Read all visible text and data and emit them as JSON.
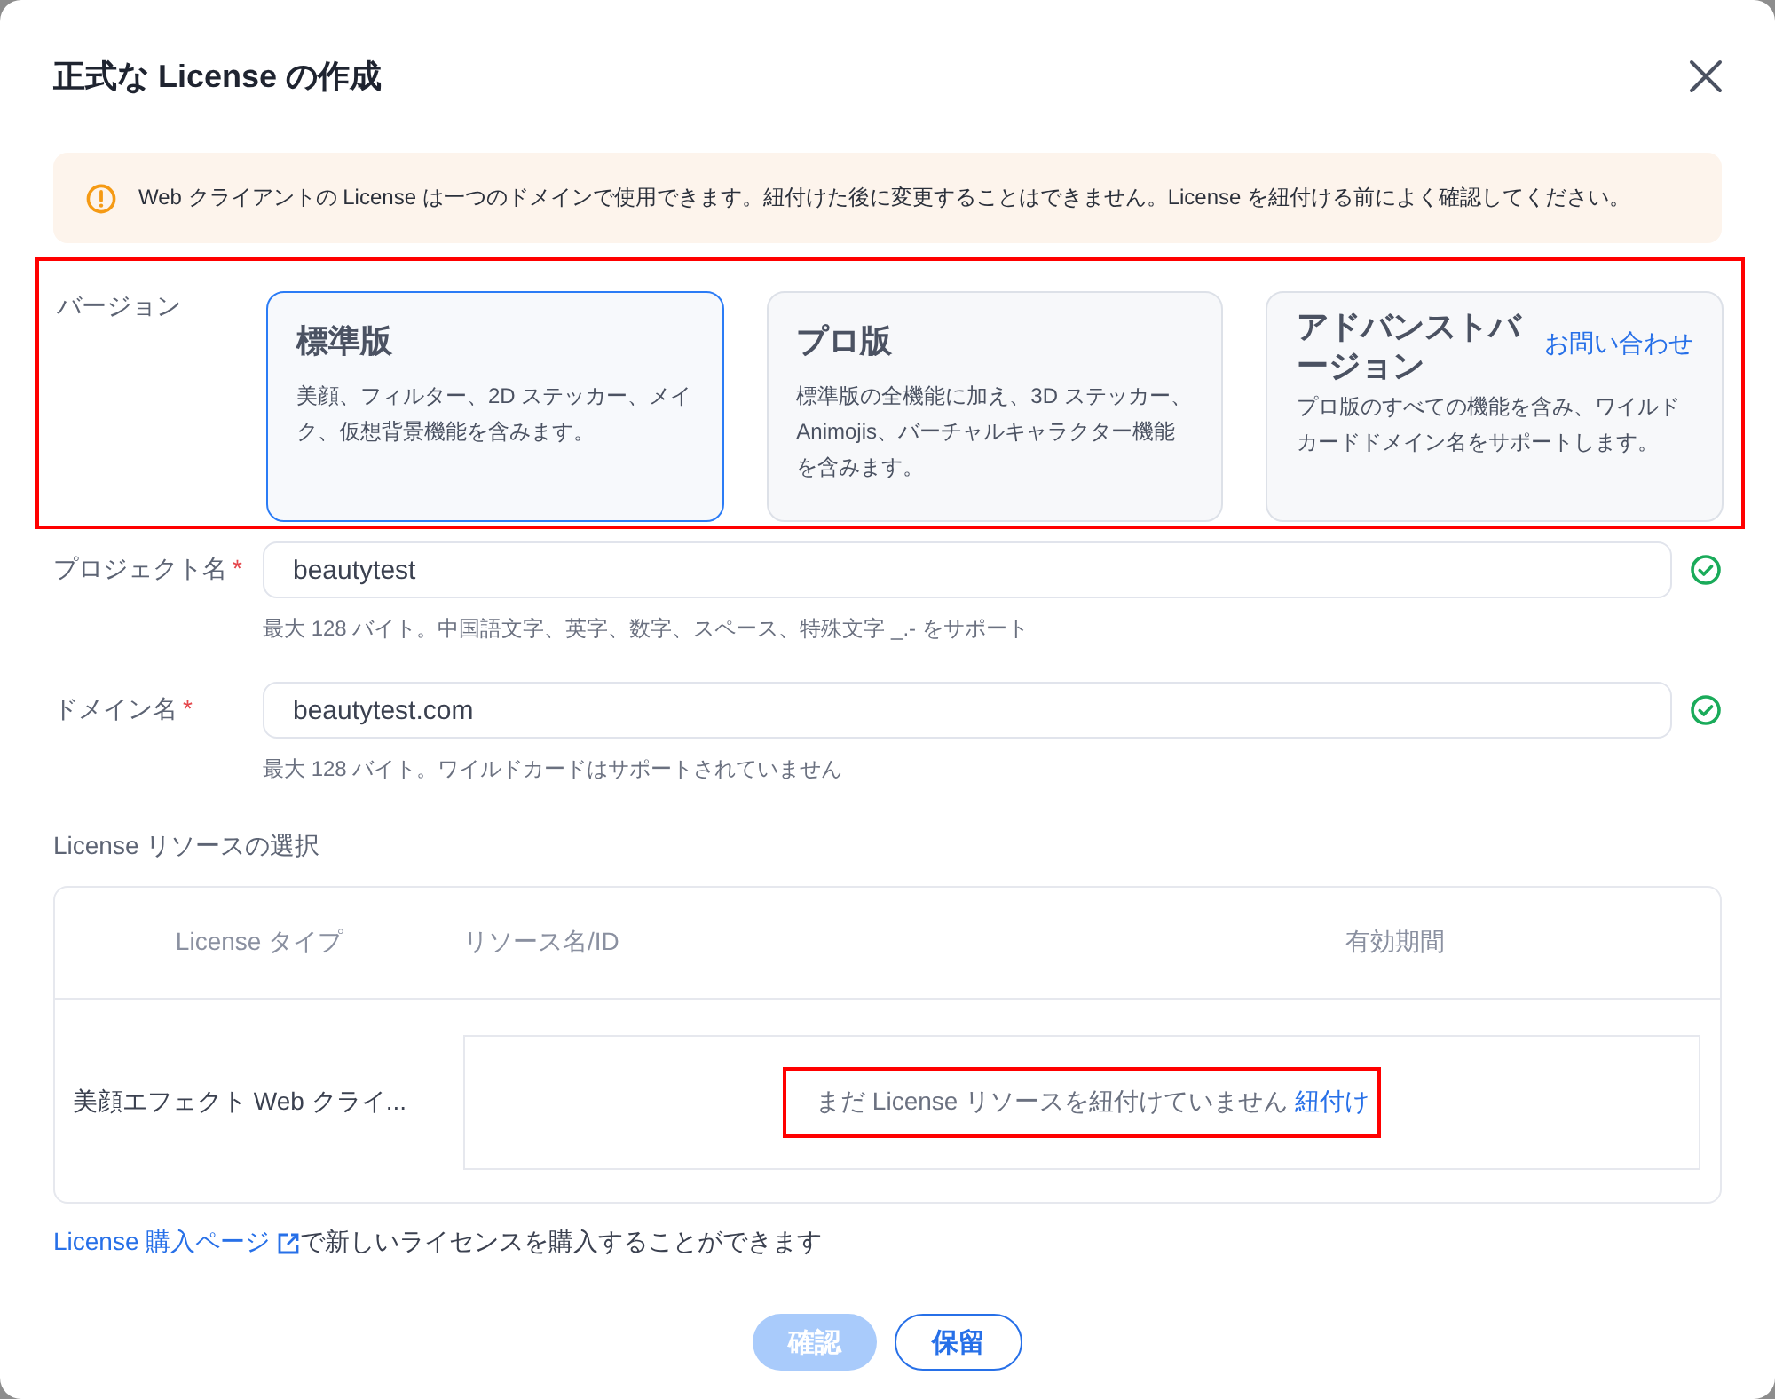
{
  "dialog": {
    "title": "正式な License の作成"
  },
  "notice": {
    "text": "Web クライアントの License は一つのドメインで使用できます。紐付けた後に変更することはできません。License を紐付ける前によく確認してください。"
  },
  "version": {
    "label": "バージョン",
    "annotated": true,
    "options": [
      {
        "name": "標準版",
        "description": "美顔、フィルター、2D ステッカー、メイク、仮想背景機能を含みます。",
        "selected": true
      },
      {
        "name": "プロ版",
        "description": "標準版の全機能に加え、3D ステッカー、Animojis、バーチャルキャラクター機能を含みます。",
        "selected": false
      },
      {
        "name": "アドバンストバージョン",
        "description": "プロ版のすべての機能を含み、ワイルドカードドメイン名をサポートします。",
        "link": "お問い合わせ",
        "selected": false
      }
    ]
  },
  "fields": [
    {
      "label": "プロジェクト名",
      "required_mark": "*",
      "value": "beautytest",
      "valid": true,
      "hint": "最大 128 バイト。中国語文字、英字、数字、スペース、特殊文字 _.- をサポート"
    },
    {
      "label": "ドメイン名",
      "required_mark": "*",
      "value": "beautytest.com",
      "valid": true,
      "hint": "最大 128 バイト。ワイルドカードはサポートされていません"
    }
  ],
  "resources": {
    "label": "License リソースの選択",
    "columns": [
      "License タイプ",
      "リソース名/ID",
      "有効期間"
    ],
    "rows": [
      {
        "type": "美顔エフェクト Web クライ...",
        "empty_message": "まだ License リソースを紐付けていません",
        "bind_link": "紐付け",
        "annotated": true
      }
    ]
  },
  "purchase": {
    "link": "License 購入ページ",
    "text": "で新しいライセンスを購入することができます"
  },
  "buttons": [
    {
      "label": "確認",
      "kind": "primary",
      "disabled": true
    },
    {
      "label": "保留",
      "kind": "secondary",
      "disabled": false
    }
  ]
}
